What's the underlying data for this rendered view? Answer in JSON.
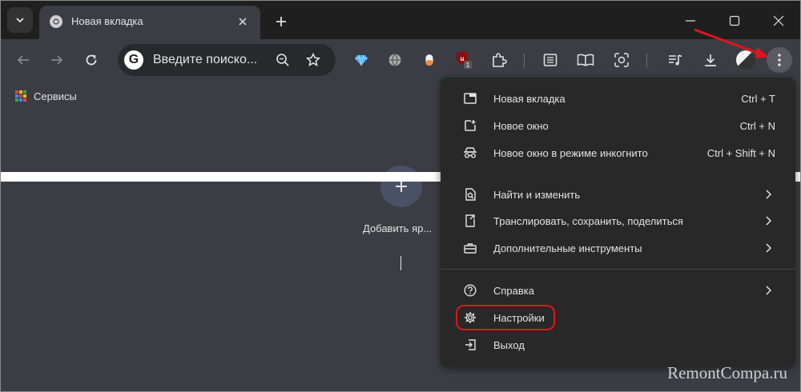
{
  "window": {
    "tab_title": "Новая вкладка",
    "new_tab_symbol": "+"
  },
  "toolbar": {
    "omnibox_placeholder": "Введите поиско...",
    "badge_count": "1"
  },
  "bookmarks": {
    "apps_label": "Сервисы"
  },
  "page": {
    "add_shortcut_symbol": "+",
    "add_shortcut_label": "Добавить яр..."
  },
  "menu": {
    "items": [
      {
        "label": "Новая вкладка",
        "shortcut": "Ctrl + T",
        "icon": "new-tab-icon"
      },
      {
        "label": "Новое окно",
        "shortcut": "Ctrl + N",
        "icon": "new-window-icon"
      },
      {
        "label": "Новое окно в режиме инкогнито",
        "shortcut": "Ctrl + Shift + N",
        "icon": "incognito-icon"
      },
      {
        "label": "Найти и изменить",
        "icon": "find-icon"
      },
      {
        "label": "Транслировать, сохранить, поделиться",
        "icon": "cast-save-share-icon"
      },
      {
        "label": "Дополнительные инструменты",
        "icon": "toolbox-icon"
      },
      {
        "label": "Справка",
        "icon": "help-icon"
      },
      {
        "label": "Настройки",
        "icon": "settings-gear-icon"
      },
      {
        "label": "Выход",
        "icon": "exit-icon"
      }
    ]
  },
  "colors": {
    "titlebar": "#1f1f1f",
    "toolbar": "#3c3d44",
    "menu_bg": "#282828",
    "highlight": "#e3141b",
    "arrow": "#e3141b"
  },
  "watermark": "RemontCompa.ru"
}
